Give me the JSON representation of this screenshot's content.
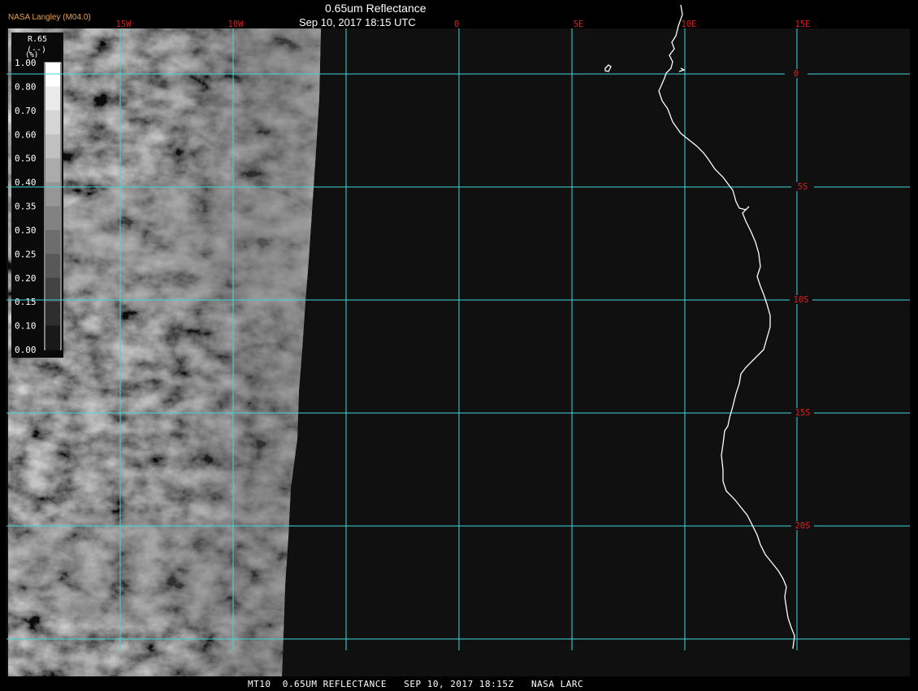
{
  "header": {
    "credit": "NASA Langley (M04.0)",
    "title": "0.65um Reflectance",
    "subtitle": "Sep 10, 2017 18:15 UTC"
  },
  "footer": {
    "caption": "MT10  0.65UM REFLECTANCE   SEP 10, 2017 18:15Z   NASA LARC"
  },
  "legend": {
    "header": "R.65",
    "unit": "(--)",
    "unit_mark": "(%)",
    "ticks": [
      "1.00",
      "0.80",
      "0.70",
      "0.60",
      "0.50",
      "0.40",
      "0.35",
      "0.30",
      "0.25",
      "0.20",
      "0.15",
      "0.10",
      "0.00"
    ]
  },
  "map": {
    "lon_labels": [
      "15W",
      "10W",
      "0",
      "5E",
      "10E",
      "15E"
    ],
    "lat_labels": [
      "0",
      "5S",
      "10S",
      "15S",
      "20S"
    ],
    "grid_color": "#40d8d8",
    "label_color": "#d82020",
    "coast_color": "#ffffff"
  }
}
